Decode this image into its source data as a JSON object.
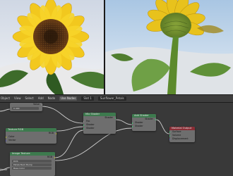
{
  "viewports": {
    "left": {
      "content": "sunflower render, sky background"
    },
    "right": {
      "content": "sunflower close-up render, sky background"
    }
  },
  "header": {
    "items": [
      {
        "id": "object",
        "label": "Object"
      },
      {
        "id": "view",
        "label": "View"
      },
      {
        "id": "select",
        "label": "Select"
      },
      {
        "id": "add",
        "label": "Add"
      },
      {
        "id": "node",
        "label": "Node"
      }
    ],
    "use_nodes_label": "Use Nodes",
    "slot_label": "Slot 1",
    "material_name": "Sunflower_Petals"
  },
  "nodes": {
    "value": {
      "title": "Value",
      "out_label": "Value",
      "value": "0.400"
    },
    "tex_a": {
      "title": "Texture RGB",
      "out_label": "RGB",
      "rows": [
        "Color",
        "Vector"
      ]
    },
    "tex_b": {
      "title": "Image Texture",
      "out_label": "RGB",
      "field1": "DOS",
      "field2": "Petals Back Bump",
      "field3": "Base Color",
      "partial": "Vector"
    },
    "mix": {
      "title": "Mix Shader",
      "out_label": "Shader",
      "rows": [
        "Fac",
        "Shader",
        "Shader"
      ]
    },
    "add": {
      "title": "Add Shader",
      "out_label": "Shader",
      "rows": [
        "Shader",
        "Shader"
      ]
    },
    "output": {
      "title": "Material Output",
      "rows": [
        "Surface",
        "Volume",
        "Displacement"
      ]
    }
  },
  "colors": {
    "accent_green": "#3d7a4e",
    "accent_red": "#8a2e36",
    "socket_yellow": "#c7c729",
    "socket_gray": "#a1a1a1",
    "socket_green": "#3fd97a",
    "socket_purple": "#6363c7",
    "link": "#d0d0d0"
  }
}
